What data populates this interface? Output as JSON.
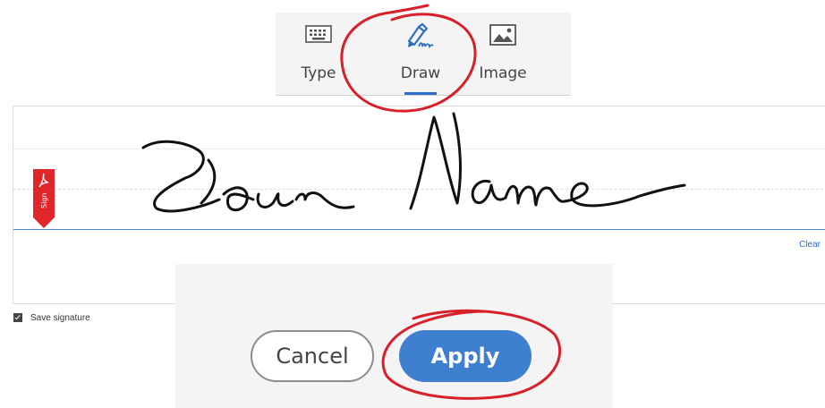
{
  "tabs": [
    {
      "label": "Type",
      "icon": "keyboard-icon",
      "active": false
    },
    {
      "label": "Draw",
      "icon": "pen-icon",
      "active": true
    },
    {
      "label": "Image",
      "icon": "image-icon",
      "active": false
    }
  ],
  "panel": {
    "tag_label": "Sign",
    "clear_label": "Clear"
  },
  "save_signature": {
    "label": "Save signature",
    "checked": true
  },
  "buttons": {
    "cancel_label": "Cancel",
    "apply_label": "Apply"
  },
  "colors": {
    "accent_blue": "#3f7fd0",
    "annotation_red": "#d8202a",
    "tag_red": "#e0262b"
  }
}
